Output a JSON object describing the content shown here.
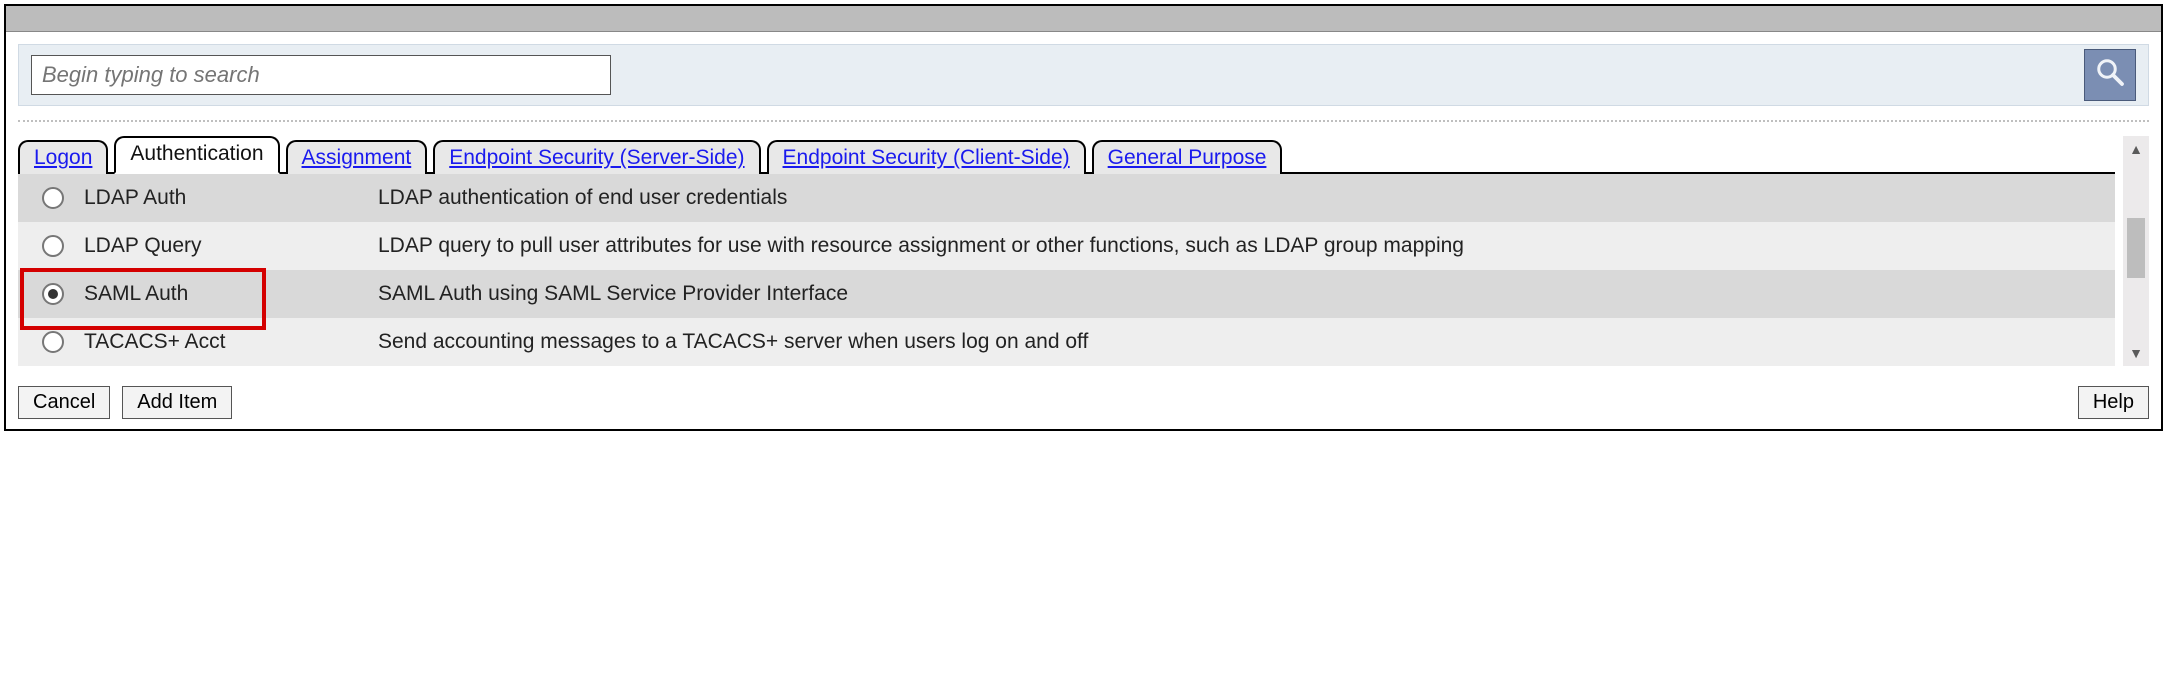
{
  "search": {
    "placeholder": "Begin typing to search"
  },
  "tabs": [
    {
      "label": "Logon",
      "active": false
    },
    {
      "label": "Authentication",
      "active": true
    },
    {
      "label": "Assignment",
      "active": false
    },
    {
      "label": "Endpoint Security (Server-Side)",
      "active": false
    },
    {
      "label": "Endpoint Security (Client-Side)",
      "active": false
    },
    {
      "label": "General Purpose",
      "active": false
    }
  ],
  "items": [
    {
      "name": "LDAP Auth",
      "desc": "LDAP authentication of end user credentials",
      "selected": false,
      "highlighted": false
    },
    {
      "name": "LDAP Query",
      "desc": "LDAP query to pull user attributes for use with resource assignment or other functions, such as LDAP group mapping",
      "selected": false,
      "highlighted": false
    },
    {
      "name": "SAML Auth",
      "desc": "SAML Auth using SAML Service Provider Interface",
      "selected": true,
      "highlighted": true
    },
    {
      "name": "TACACS+ Acct",
      "desc": "Send accounting messages to a TACACS+ server when users log on and off",
      "selected": false,
      "highlighted": false
    }
  ],
  "footer": {
    "cancel": "Cancel",
    "add": "Add Item",
    "help": "Help"
  }
}
